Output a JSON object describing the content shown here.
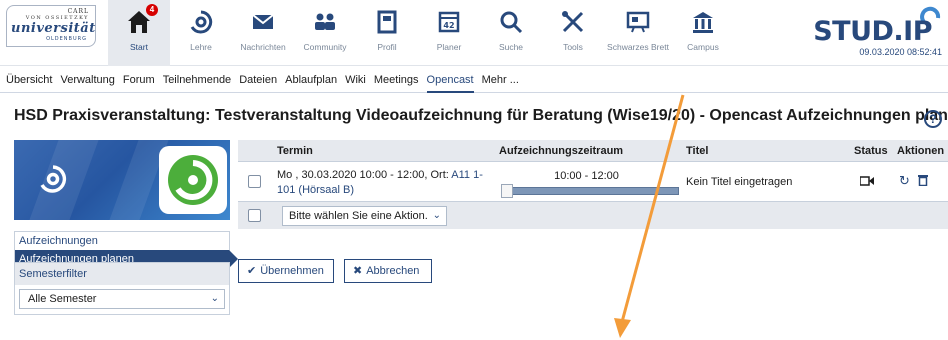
{
  "logo": {
    "line1": "CARL",
    "line2": "VON OSSIETZKY",
    "line3": "universität",
    "line4": "OLDENBURG"
  },
  "nav": [
    {
      "label": "Start",
      "icon": "home-icon",
      "badge": "4"
    },
    {
      "label": "Lehre",
      "icon": "lehre-icon"
    },
    {
      "label": "Nachrichten",
      "icon": "mail-icon"
    },
    {
      "label": "Community",
      "icon": "community-icon"
    },
    {
      "label": "Profil",
      "icon": "profile-icon"
    },
    {
      "label": "Planer",
      "icon": "calendar-icon",
      "day": "42"
    },
    {
      "label": "Suche",
      "icon": "search-icon"
    },
    {
      "label": "Tools",
      "icon": "tools-icon"
    },
    {
      "label": "Schwarzes Brett",
      "icon": "board-icon"
    },
    {
      "label": "Campus",
      "icon": "campus-icon"
    }
  ],
  "brand": {
    "name": "STUD.IP",
    "datetime": "09.03.2020 08:52:41"
  },
  "subnav": [
    "Übersicht",
    "Verwaltung",
    "Forum",
    "Teilnehmende",
    "Dateien",
    "Ablaufplan",
    "Wiki",
    "Meetings",
    "Opencast",
    "Mehr ..."
  ],
  "page_title": "HSD Praxisveranstaltung: Testveranstaltung Videoaufzeichnung für Beratung (Wise19/20) - Opencast Aufzeichnungen planen",
  "help": "?",
  "sidebar": {
    "items": [
      "Aufzeichnungen",
      "Aufzeichnungen planen"
    ],
    "filter_title": "Semesterfilter",
    "filter_value": "Alle Semester"
  },
  "table": {
    "headers": [
      "Termin",
      "Aufzeichnungszeitraum",
      "Titel",
      "Status",
      "Aktionen"
    ],
    "row": {
      "termin_text": "Mo , 30.03.2020 10:00 - 12:00, Ort:",
      "termin_link": "A11 1-101 (Hörsaal B)",
      "zeitraum": "10:00 - 12:00",
      "zeitraum_fraction": 0.0,
      "titel": "Kein Titel eingetragen"
    },
    "bulk_action": "Bitte wählen Sie eine Aktion."
  },
  "buttons": {
    "apply": "Übernehmen",
    "cancel": "Abbrechen"
  },
  "colors": {
    "primary": "#28497c",
    "annotation_arrow": "#f39c3a",
    "badge": "#d60000"
  }
}
